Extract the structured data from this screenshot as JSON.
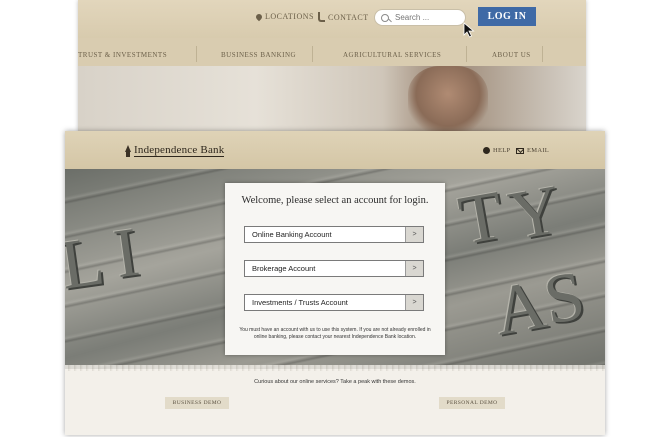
{
  "background_site": {
    "locations_label": "LOCATIONS",
    "contact_label": "CONTACT",
    "search_placeholder": "Search ...",
    "login_label": "LOG IN",
    "nav": [
      "TRUST & INVESTMENTS",
      "BUSINESS BANKING",
      "AGRICULTURAL SERVICES",
      "ABOUT US"
    ]
  },
  "login_page": {
    "brand": "Independence Bank",
    "help_label": "HELP",
    "email_label": "EMAIL",
    "dialog_title": "Welcome, please select an account for login.",
    "accounts": [
      {
        "label": "Online Banking Account",
        "arrow": ">"
      },
      {
        "label": "Brokerage Account",
        "arrow": ">"
      },
      {
        "label": "Investments / Trusts Account",
        "arrow": ">"
      }
    ],
    "note": "You must have an account with us to use this system. If you are not already enrolled in online banking, please contact your nearest Independence Bank location.",
    "demo_prompt": "Curious about our online services? Take a peak with these demos.",
    "business_demo_label": "BUSINESS DEMO",
    "personal_demo_label": "PERSONAL DEMO"
  },
  "colors": {
    "login_button": "#3f6aa6",
    "header_tan": "#d8cbae",
    "demo_button": "#e2dbc9"
  }
}
